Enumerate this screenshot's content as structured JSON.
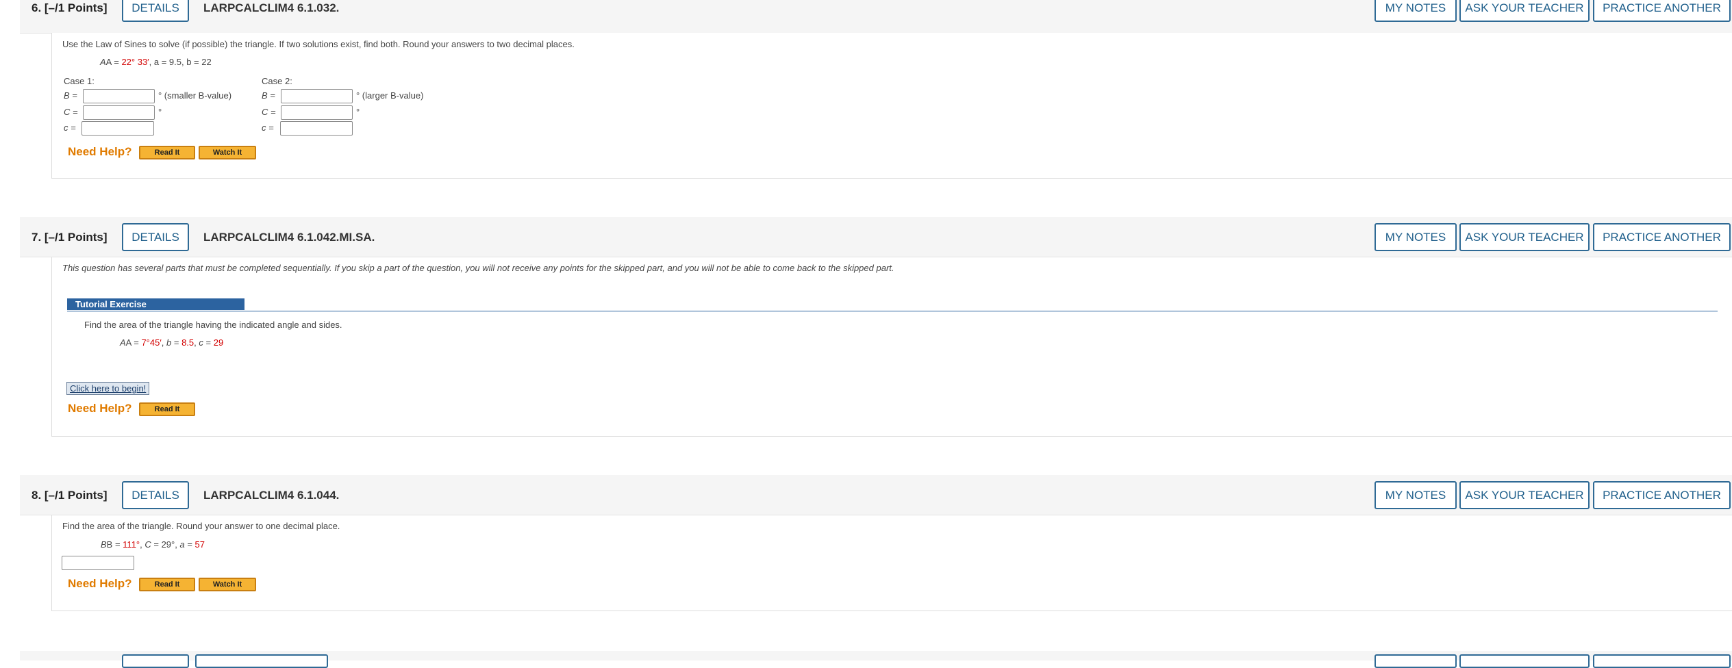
{
  "questions": [
    {
      "points": "6.  [–/1 Points]",
      "details_label": "DETAILS",
      "code": "LARPCALCLIM4 6.1.032.",
      "my_notes": "MY NOTES",
      "ask_teacher": "ASK YOUR TEACHER",
      "practice": "PRACTICE ANOTHER",
      "prompt": "Use the Law of Sines to solve (if possible) the triangle. If two solutions exist, find both. Round your answers to two decimal places.",
      "given": {
        "A_label": "A = ",
        "A_val": "22° 33′",
        "a_label": ",  a = 9.5,  b = 22"
      },
      "case1": {
        "title": "Case 1:",
        "B": "B =",
        "C": "C =",
        "c": "c =",
        "B_note": "° (smaller B-value)",
        "C_note": "°"
      },
      "case2": {
        "title": "Case 2:",
        "B": "B =",
        "C": "C =",
        "c": "c =",
        "B_note": "° (larger B-value)",
        "C_note": "°"
      },
      "need_help": "Need Help?",
      "read_it": "Read It",
      "watch_it": "Watch It"
    },
    {
      "points": "7.  [–/1 Points]",
      "details_label": "DETAILS",
      "code": "LARPCALCLIM4 6.1.042.MI.SA.",
      "my_notes": "MY NOTES",
      "ask_teacher": "ASK YOUR TEACHER",
      "practice": "PRACTICE ANOTHER",
      "notice": "This question has several parts that must be completed sequentially. If you skip a part of the question, you will not receive any points for the skipped part, and you will not be able to come back to the skipped part.",
      "tutorial_label": "Tutorial Exercise",
      "prompt": "Find the area of the triangle having the indicated angle and sides.",
      "given": {
        "A_label": "A = ",
        "A_val": "7°45′",
        "b_label": ",   b = ",
        "b_val": "8.5",
        "c_label": ",   c = ",
        "c_val": "29"
      },
      "begin": "Click here to begin!",
      "need_help": "Need Help?",
      "read_it": "Read It"
    },
    {
      "points": "8.  [–/1 Points]",
      "details_label": "DETAILS",
      "code": "LARPCALCLIM4 6.1.044.",
      "my_notes": "MY NOTES",
      "ask_teacher": "ASK YOUR TEACHER",
      "practice": "PRACTICE ANOTHER",
      "prompt": "Find the area of the triangle. Round your answer to one decimal place.",
      "given": {
        "B_label": "B = ",
        "B_val": "111°",
        "C_label": ",    C = 29°,    a = ",
        "a_val": "57"
      },
      "need_help": "Need Help?",
      "read_it": "Read It",
      "watch_it": "Watch It"
    }
  ]
}
